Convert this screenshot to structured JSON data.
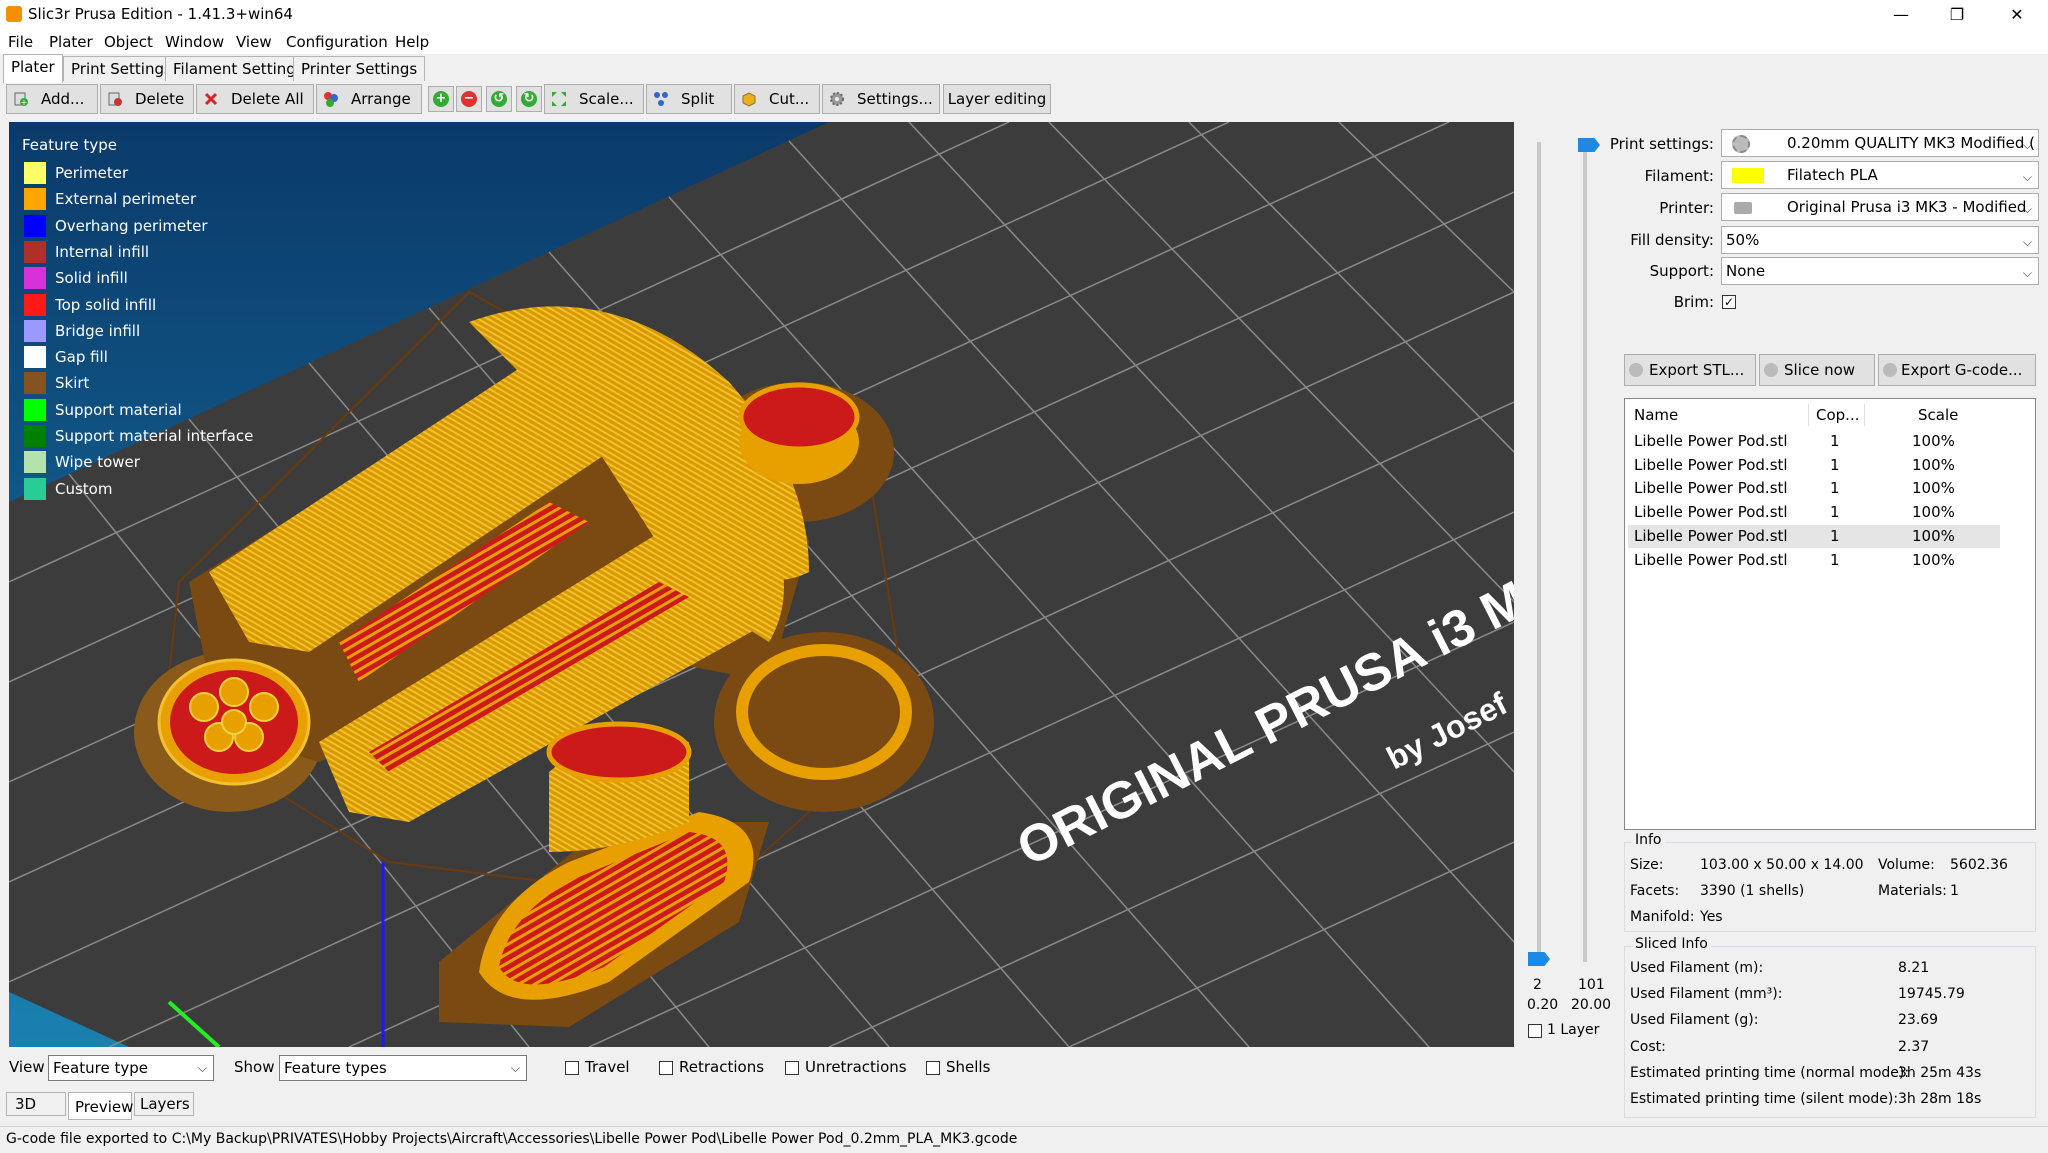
{
  "window": {
    "title": "Slic3r Prusa Edition - 1.41.3+win64",
    "controls": {
      "minimize": "—",
      "maximize": "❐",
      "close": "✕"
    }
  },
  "menu": [
    "File",
    "Plater",
    "Object",
    "Window",
    "View",
    "Configuration",
    "Help"
  ],
  "tabs": [
    "Plater",
    "Print Settings",
    "Filament Settings",
    "Printer Settings"
  ],
  "toolbar": {
    "add": "Add...",
    "delete": "Delete",
    "delete_all": "Delete All",
    "arrange": "Arrange",
    "scale": "Scale...",
    "split": "Split",
    "cut": "Cut...",
    "settings": "Settings...",
    "layer_editing": "Layer editing"
  },
  "legend": {
    "title": "Feature type",
    "items": [
      {
        "label": "Perimeter",
        "color": "#ffff66"
      },
      {
        "label": "External perimeter",
        "color": "#ffa500"
      },
      {
        "label": "Overhang perimeter",
        "color": "#0000ff"
      },
      {
        "label": "Internal infill",
        "color": "#b03029"
      },
      {
        "label": "Solid infill",
        "color": "#d732d7"
      },
      {
        "label": "Top solid infill",
        "color": "#ff1a1a"
      },
      {
        "label": "Bridge infill",
        "color": "#9999ff"
      },
      {
        "label": "Gap fill",
        "color": "#ffffff"
      },
      {
        "label": "Skirt",
        "color": "#845321"
      },
      {
        "label": "Support material",
        "color": "#00ff00"
      },
      {
        "label": "Support material interface",
        "color": "#008000"
      },
      {
        "label": "Wipe tower",
        "color": "#b3e3ab"
      },
      {
        "label": "Custom",
        "color": "#28cc94"
      }
    ]
  },
  "bed": {
    "text_line1": "ORIGINAL PRUSA i3 M",
    "text_line2": "by Josef"
  },
  "layer_slider": {
    "low_layer": "2",
    "high_layer": "101",
    "low_z": "0.20",
    "high_z": "20.00",
    "one_layer": "1 Layer"
  },
  "view_bar": {
    "view_label": "View",
    "view_value": "Feature type",
    "show_label": "Show",
    "show_value": "Feature types",
    "checkboxes": [
      "Travel",
      "Retractions",
      "Unretractions",
      "Shells"
    ]
  },
  "bottom_tabs": [
    "3D",
    "Preview",
    "Layers"
  ],
  "settings": {
    "print_label": "Print settings:",
    "print_value": "0.20mm QUALITY MK3 Modified (",
    "filament_label": "Filament:",
    "filament_value": "Filatech PLA",
    "filament_color": "#ffff00",
    "printer_label": "Printer:",
    "printer_value": "Original Prusa i3 MK3 - Modified",
    "fill_label": "Fill density:",
    "fill_value": "50%",
    "support_label": "Support:",
    "support_value": "None",
    "brim_label": "Brim:",
    "brim_checked": true
  },
  "actions": {
    "export_stl": "Export STL...",
    "slice_now": "Slice now",
    "export_gcode": "Export G-code..."
  },
  "objects": {
    "headers": [
      "Name",
      "Cop...",
      "Scale"
    ],
    "rows": [
      {
        "name": "Libelle Power Pod.stl",
        "copies": "1",
        "scale": "100%"
      },
      {
        "name": "Libelle Power Pod.stl",
        "copies": "1",
        "scale": "100%"
      },
      {
        "name": "Libelle Power Pod.stl",
        "copies": "1",
        "scale": "100%"
      },
      {
        "name": "Libelle Power Pod.stl",
        "copies": "1",
        "scale": "100%"
      },
      {
        "name": "Libelle Power Pod.stl",
        "copies": "1",
        "scale": "100%"
      },
      {
        "name": "Libelle Power Pod.stl",
        "copies": "1",
        "scale": "100%"
      }
    ]
  },
  "info": {
    "title": "Info",
    "size_label": "Size:",
    "size_value": "103.00 x 50.00 x 14.00",
    "volume_label": "Volume:",
    "volume_value": "5602.36",
    "facets_label": "Facets:",
    "facets_value": "3390 (1 shells)",
    "materials_label": "Materials:",
    "materials_value": "1",
    "manifold_label": "Manifold:",
    "manifold_value": "Yes"
  },
  "sliced_info": {
    "title": "Sliced Info",
    "rows": [
      {
        "label": "Used Filament (m):",
        "value": "8.21"
      },
      {
        "label": "Used Filament (mm³):",
        "value": "19745.79"
      },
      {
        "label": "Used Filament (g):",
        "value": "23.69"
      },
      {
        "label": "Cost:",
        "value": "2.37"
      },
      {
        "label": "Estimated printing time (normal mode):",
        "value": "3h 25m 43s"
      },
      {
        "label": "Estimated printing time (silent mode):",
        "value": "3h 28m 18s"
      }
    ]
  },
  "status": "G-code file exported to C:\\My Backup\\PRIVATES\\Hobby Projects\\Aircraft\\Accessories\\Libelle Power Pod\\Libelle Power Pod_0.2mm_PLA_MK3.gcode"
}
